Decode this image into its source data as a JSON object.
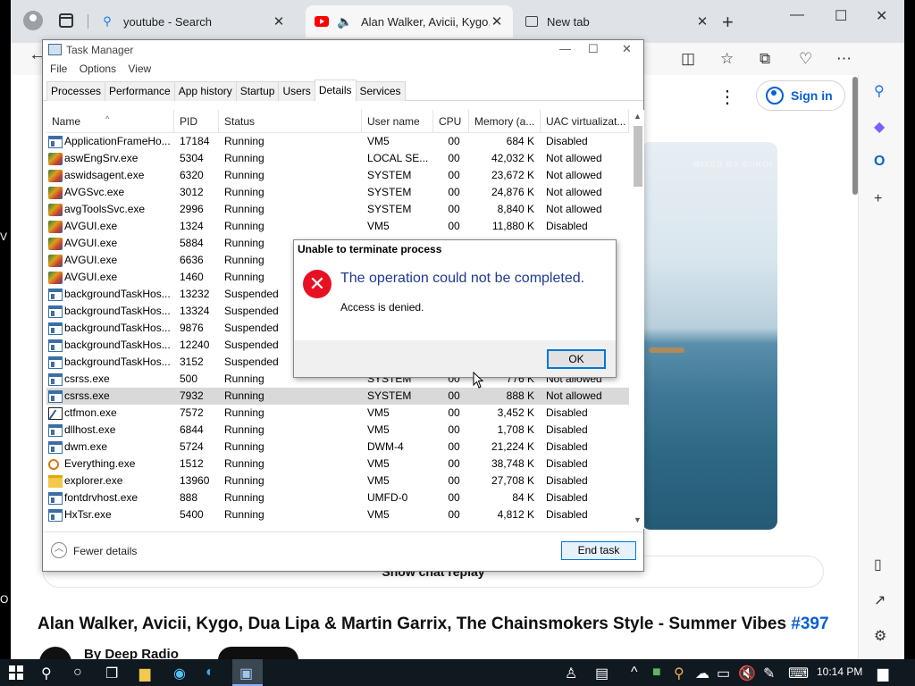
{
  "browser": {
    "tabs": [
      {
        "label": "youtube - Search",
        "icon": "search-icon"
      },
      {
        "label": "Alan Walker, Avicii, Kygo, D",
        "icon": "youtube-icon"
      },
      {
        "label": "New tab",
        "icon": "newtab-icon"
      }
    ],
    "signin_label": "Sign in",
    "chat_replay": "Show chat replay",
    "video_title": "Alan Walker, Avicii, Kygo, Dua Lipa & Martin Garrix, The Chainsmokers Style - Summer Vibes",
    "video_tag": "#397",
    "channel_name": "By Deep Radio",
    "video_watermark": "MIXED BY BUKOI"
  },
  "task_manager": {
    "title": "Task Manager",
    "menu": [
      "File",
      "Options",
      "View"
    ],
    "tabs": [
      "Processes",
      "Performance",
      "App history",
      "Startup",
      "Users",
      "Details",
      "Services"
    ],
    "active_tab": "Details",
    "columns": [
      "Name",
      "PID",
      "Status",
      "User name",
      "CPU",
      "Memory (a...",
      "UAC virtualizat..."
    ],
    "rows": [
      {
        "icon": "window",
        "name": "ApplicationFrameHo...",
        "pid": "17184",
        "status": "Running",
        "user": "VM5",
        "cpu": "00",
        "mem": "684 K",
        "uac": "Disabled"
      },
      {
        "icon": "avast",
        "name": "aswEngSrv.exe",
        "pid": "5304",
        "status": "Running",
        "user": "LOCAL SE...",
        "cpu": "00",
        "mem": "42,032 K",
        "uac": "Not allowed"
      },
      {
        "icon": "avast",
        "name": "aswidsagent.exe",
        "pid": "6320",
        "status": "Running",
        "user": "SYSTEM",
        "cpu": "00",
        "mem": "23,672 K",
        "uac": "Not allowed"
      },
      {
        "icon": "avast",
        "name": "AVGSvc.exe",
        "pid": "3012",
        "status": "Running",
        "user": "SYSTEM",
        "cpu": "00",
        "mem": "24,876 K",
        "uac": "Not allowed"
      },
      {
        "icon": "avast",
        "name": "avgToolsSvc.exe",
        "pid": "2996",
        "status": "Running",
        "user": "SYSTEM",
        "cpu": "00",
        "mem": "8,840 K",
        "uac": "Not allowed"
      },
      {
        "icon": "avast",
        "name": "AVGUI.exe",
        "pid": "1324",
        "status": "Running",
        "user": "VM5",
        "cpu": "00",
        "mem": "11,880 K",
        "uac": "Disabled"
      },
      {
        "icon": "avast",
        "name": "AVGUI.exe",
        "pid": "5884",
        "status": "Running",
        "user": "",
        "cpu": "",
        "mem": "",
        "uac": ""
      },
      {
        "icon": "avast",
        "name": "AVGUI.exe",
        "pid": "6636",
        "status": "Running",
        "user": "",
        "cpu": "",
        "mem": "",
        "uac": ""
      },
      {
        "icon": "avast",
        "name": "AVGUI.exe",
        "pid": "1460",
        "status": "Running",
        "user": "",
        "cpu": "",
        "mem": "",
        "uac": ""
      },
      {
        "icon": "window",
        "name": "backgroundTaskHos...",
        "pid": "13232",
        "status": "Suspended",
        "user": "",
        "cpu": "",
        "mem": "",
        "uac": ""
      },
      {
        "icon": "window",
        "name": "backgroundTaskHos...",
        "pid": "13324",
        "status": "Suspended",
        "user": "",
        "cpu": "",
        "mem": "",
        "uac": ""
      },
      {
        "icon": "window",
        "name": "backgroundTaskHos...",
        "pid": "9876",
        "status": "Suspended",
        "user": "",
        "cpu": "",
        "mem": "",
        "uac": ""
      },
      {
        "icon": "window",
        "name": "backgroundTaskHos...",
        "pid": "12240",
        "status": "Suspended",
        "user": "",
        "cpu": "",
        "mem": "",
        "uac": ""
      },
      {
        "icon": "window",
        "name": "backgroundTaskHos...",
        "pid": "3152",
        "status": "Suspended",
        "user": "",
        "cpu": "",
        "mem": "",
        "uac": ""
      },
      {
        "icon": "window",
        "name": "csrss.exe",
        "pid": "500",
        "status": "Running",
        "user": "SYSTEM",
        "cpu": "00",
        "mem": "776 K",
        "uac": "Not allowed"
      },
      {
        "icon": "window",
        "name": "csrss.exe",
        "pid": "7932",
        "status": "Running",
        "user": "SYSTEM",
        "cpu": "00",
        "mem": "888 K",
        "uac": "Not allowed",
        "selected": true
      },
      {
        "icon": "pen",
        "name": "ctfmon.exe",
        "pid": "7572",
        "status": "Running",
        "user": "VM5",
        "cpu": "00",
        "mem": "3,452 K",
        "uac": "Disabled"
      },
      {
        "icon": "window",
        "name": "dllhost.exe",
        "pid": "6844",
        "status": "Running",
        "user": "VM5",
        "cpu": "00",
        "mem": "1,708 K",
        "uac": "Disabled"
      },
      {
        "icon": "window",
        "name": "dwm.exe",
        "pid": "5724",
        "status": "Running",
        "user": "DWM-4",
        "cpu": "00",
        "mem": "21,224 K",
        "uac": "Disabled"
      },
      {
        "icon": "search",
        "name": "Everything.exe",
        "pid": "1512",
        "status": "Running",
        "user": "VM5",
        "cpu": "00",
        "mem": "38,748 K",
        "uac": "Disabled"
      },
      {
        "icon": "folder",
        "name": "explorer.exe",
        "pid": "13960",
        "status": "Running",
        "user": "VM5",
        "cpu": "00",
        "mem": "27,708 K",
        "uac": "Disabled"
      },
      {
        "icon": "window",
        "name": "fontdrvhost.exe",
        "pid": "888",
        "status": "Running",
        "user": "UMFD-0",
        "cpu": "00",
        "mem": "84 K",
        "uac": "Disabled"
      },
      {
        "icon": "window",
        "name": "HxTsr.exe",
        "pid": "5400",
        "status": "Running",
        "user": "VM5",
        "cpu": "00",
        "mem": "4,812 K",
        "uac": "Disabled"
      }
    ],
    "fewer_details": "Fewer details",
    "end_task": "End task"
  },
  "dialog": {
    "title": "Unable to terminate process",
    "main": "The operation could not be completed.",
    "sub": "Access is denied.",
    "ok": "OK"
  },
  "taskbar": {
    "clock": "10:14 PM"
  }
}
